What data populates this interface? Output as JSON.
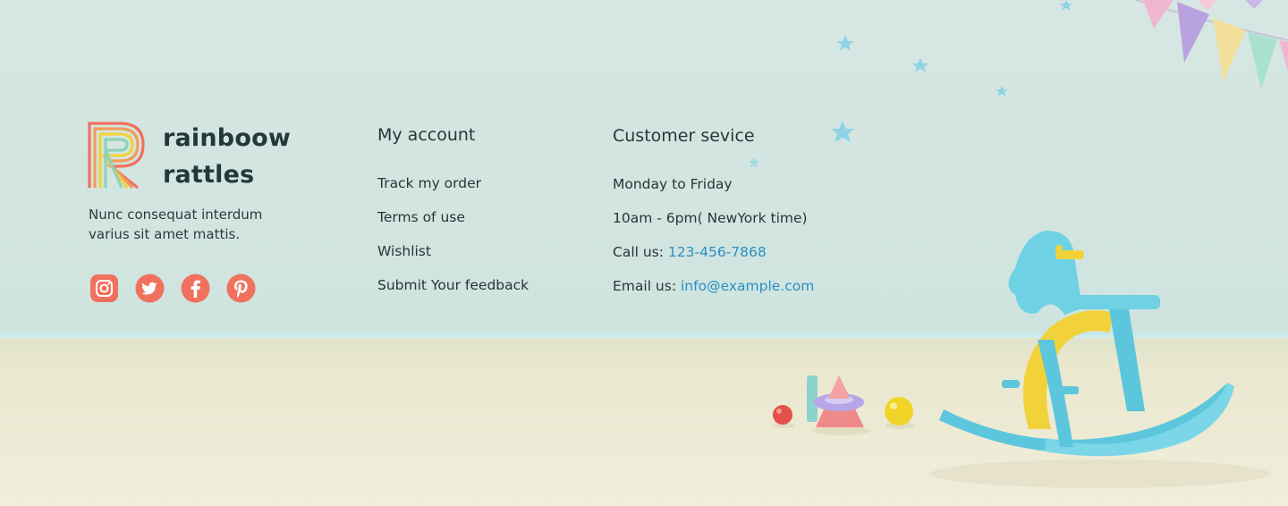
{
  "brand": {
    "line1": "rainboow",
    "line2": "rattles",
    "tagline_line1": "Nunc consequat interdum",
    "tagline_line2": "varius sit amet mattis."
  },
  "social": [
    {
      "icon": "instagram-icon",
      "color": "#f0715e"
    },
    {
      "icon": "twitter-icon",
      "color": "#f0715e"
    },
    {
      "icon": "facebook-icon",
      "color": "#f0715e"
    },
    {
      "icon": "pinterest-icon",
      "color": "#f0715e"
    }
  ],
  "account": {
    "title": "My account",
    "links": [
      "Track my order",
      "Terms of use",
      "Wishlist",
      "Submit Your feedback"
    ]
  },
  "service": {
    "title": "Customer sevice",
    "days": "Monday to Friday",
    "hours": "10am - 6pm( NewYork time)",
    "call_label": "Call us:",
    "phone": "123-456-7868",
    "email_label": "Email us:",
    "email": "info@example.com"
  },
  "colors": {
    "link_blue": "#2a8fc4",
    "accent_coral": "#f0715e",
    "text": "#2a3436"
  }
}
